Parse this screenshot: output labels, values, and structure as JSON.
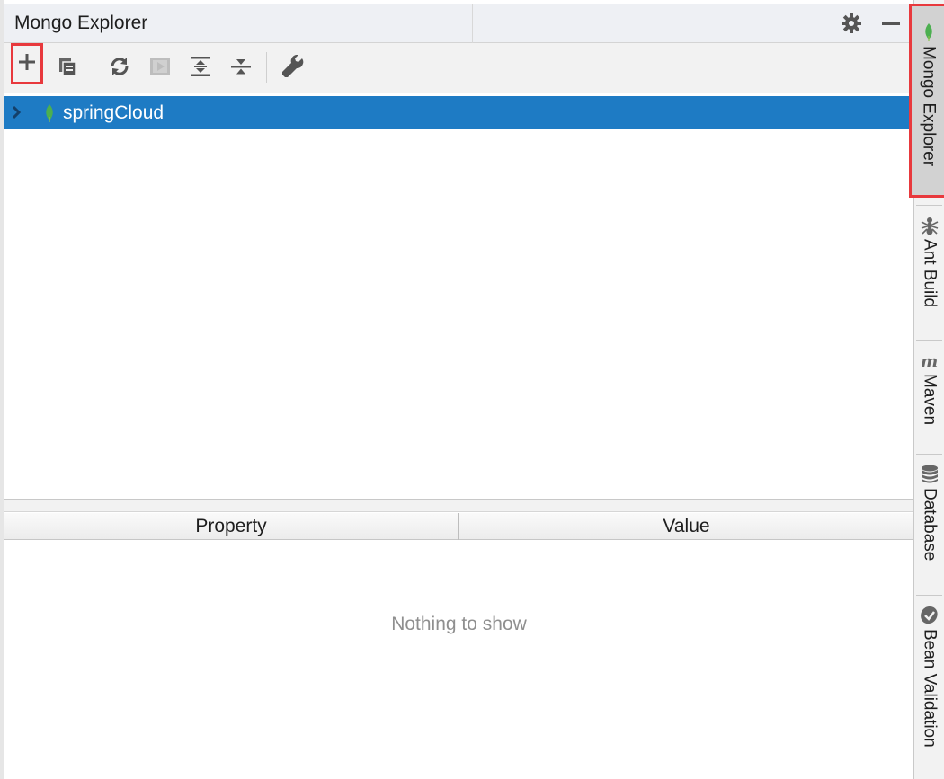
{
  "window": {
    "title": "Mongo Explorer"
  },
  "title_actions": {
    "settings_icon": "gear-icon",
    "minimize_icon": "minimize-icon"
  },
  "toolbar": {
    "buttons": [
      {
        "icon": "add-icon",
        "highlighted": true
      },
      {
        "icon": "copy-icon"
      },
      {
        "icon": "refresh-icon"
      },
      {
        "icon": "run-icon",
        "disabled": true
      },
      {
        "icon": "expand-all-icon"
      },
      {
        "icon": "collapse-all-icon"
      },
      {
        "icon": "wrench-icon"
      }
    ]
  },
  "tree": {
    "items": [
      {
        "label": "springCloud",
        "icon": "mongo-leaf-icon",
        "selected": true,
        "expanded": false
      }
    ]
  },
  "properties_table": {
    "columns": [
      "Property",
      "Value"
    ],
    "empty_text": "Nothing to show"
  },
  "side_tabs": [
    {
      "label": "Mongo Explorer",
      "icon": "mongo-leaf-icon",
      "active": true
    },
    {
      "label": "Ant Build",
      "icon": "ant-icon"
    },
    {
      "label": "Maven",
      "icon": "maven-icon"
    },
    {
      "label": "Database",
      "icon": "database-icon"
    },
    {
      "label": "Bean Validation",
      "icon": "bean-validation-icon"
    }
  ],
  "colors": {
    "selection": "#1e7bc4",
    "highlight_border": "#e8393d",
    "mongo_green": "#4caf50"
  }
}
